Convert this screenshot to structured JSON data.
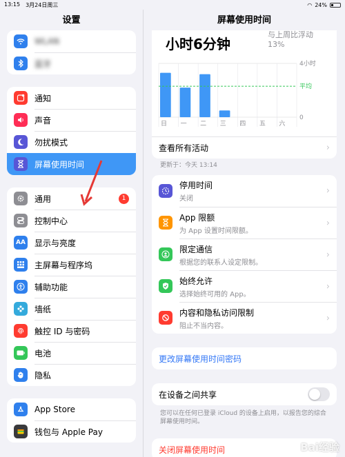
{
  "status": {
    "time": "13:15",
    "date": "3月24日周三",
    "battery": "24%"
  },
  "sidebar": {
    "title": "设置",
    "top_items": [
      {
        "label": "WLAN",
        "icon": "wifi-icon",
        "color": "#2f80ed"
      },
      {
        "label": "蓝牙",
        "icon": "bluetooth-icon",
        "color": "#2f80ed"
      }
    ],
    "group1": [
      {
        "label": "通知",
        "icon": "notification-icon",
        "color": "#ff3b30"
      },
      {
        "label": "声音",
        "icon": "sound-icon",
        "color": "#ff2d55"
      },
      {
        "label": "勿扰模式",
        "icon": "moon-icon",
        "color": "#5856d6"
      },
      {
        "label": "屏幕使用时间",
        "icon": "hourglass-icon",
        "color": "#5856d6"
      }
    ],
    "group2": [
      {
        "label": "通用",
        "icon": "gear-icon",
        "color": "#8e8e93",
        "badge": "1"
      },
      {
        "label": "控制中心",
        "icon": "switches-icon",
        "color": "#8e8e93"
      },
      {
        "label": "显示与亮度",
        "icon": "display-icon",
        "color": "#2f80ed"
      },
      {
        "label": "主屏幕与程序坞",
        "icon": "home-grid-icon",
        "color": "#2f80ed"
      },
      {
        "label": "辅助功能",
        "icon": "accessibility-icon",
        "color": "#2f80ed"
      },
      {
        "label": "墙纸",
        "icon": "wallpaper-icon",
        "color": "#34aadc"
      },
      {
        "label": "触控 ID 与密码",
        "icon": "fingerprint-icon",
        "color": "#ff3b30"
      },
      {
        "label": "电池",
        "icon": "battery-icon",
        "color": "#34c759"
      },
      {
        "label": "隐私",
        "icon": "hand-icon",
        "color": "#2f80ed"
      }
    ],
    "group3": [
      {
        "label": "App Store",
        "icon": "appstore-icon",
        "color": "#2f80ed"
      },
      {
        "label": "钱包与 Apple Pay",
        "icon": "wallet-icon",
        "color": "#3a3a3c"
      }
    ]
  },
  "main": {
    "title": "屏幕使用时间",
    "usage": {
      "big": "小时6分钟",
      "compare": "与上周比浮动",
      "compare_pct": "13%"
    },
    "view_all": "查看所有活动",
    "updated": "更新于：今天 13:14",
    "items": [
      {
        "t1": "停用时间",
        "t2": "关闭",
        "icon": "downtime-icon",
        "color": "#5856d6"
      },
      {
        "t1": "App 限额",
        "t2": "为 App 设置时间限额。",
        "icon": "hourglass-icon",
        "color": "#ff9500"
      },
      {
        "t1": "限定通信",
        "t2": "根据您的联系人设定限制。",
        "icon": "contact-icon",
        "color": "#34c759"
      },
      {
        "t1": "始终允许",
        "t2": "选择始终可用的 App。",
        "icon": "checkmark-icon",
        "color": "#34c759"
      },
      {
        "t1": "内容和隐私访问限制",
        "t2": "阻止不当内容。",
        "icon": "block-icon",
        "color": "#ff3b30"
      }
    ],
    "change_passcode": "更改屏幕使用时间密码",
    "share_label": "在设备之间共享",
    "share_note": "您可以在任何已登录 iCloud 的设备上启用，以报告您的综合屏幕使用时间。",
    "turn_off": "关闭屏幕使用时间"
  },
  "chart_data": {
    "type": "bar",
    "categories": [
      "日",
      "一",
      "二",
      "三",
      "四",
      "五",
      "六"
    ],
    "values": [
      3.3,
      2.2,
      3.2,
      0.5,
      0,
      0,
      0
    ],
    "average": 2.3,
    "y_labels": [
      "4小时",
      "0"
    ],
    "average_label": "平均",
    "ylim": [
      0,
      4
    ],
    "bar_color": "#3f97f6",
    "average_color": "#34c759"
  },
  "watermark": "Bai经验"
}
